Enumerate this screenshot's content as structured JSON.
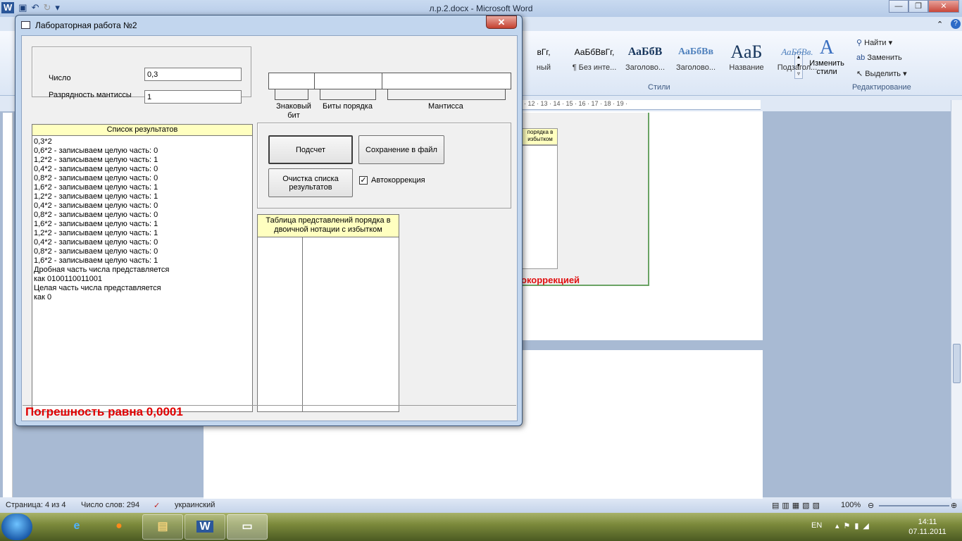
{
  "word": {
    "window_title": "л.р.2.docx - Microsoft Word",
    "styles": [
      {
        "preview": "вГг,",
        "label": "ный"
      },
      {
        "preview": "АаБбВвГг,",
        "label": "¶ Без инте..."
      },
      {
        "preview": "АаБбВ",
        "label": "Заголово..."
      },
      {
        "preview": "АаБбВв",
        "label": "Заголово..."
      },
      {
        "preview": "АаБ",
        "label": "Название"
      },
      {
        "preview": "АаБбВв.",
        "label": "Подзагол..."
      }
    ],
    "change_styles": "Изменить стили",
    "group_styles": "Стили",
    "find": "Найти",
    "replace": "Заменить",
    "select": "Выделить",
    "group_editing": "Редактирование",
    "ruler_text": "· 12 · 13 · 14 · 15 · 16 · 17 · 18 · 19 ·",
    "snapshot_header": "порядка в избытком",
    "snapshot_red": "окоррекцией",
    "status": {
      "page": "Страница: 4 из 4",
      "words": "Число слов: 294",
      "language": "украинский",
      "zoom": "100%"
    }
  },
  "taskbar": {
    "lang": "EN",
    "time": "14:11",
    "date": "07.11.2011"
  },
  "dialog": {
    "title": "Лабораторная работа №2",
    "number_label": "Число",
    "number_value": "0,3",
    "mantissa_label": "Разрядность мантиссы",
    "mantissa_value": "1",
    "sign_label": "Знаковый бит",
    "exponent_label": "Биты порядка",
    "mantissa_bits_label": "Мантисса",
    "results_header": "Список результатов",
    "results": [
      "0,3*2",
      "0,6*2 - записываем целую часть: 0",
      "1,2*2 - записываем целую часть: 1",
      "0,4*2 - записываем целую часть: 0",
      "0,8*2 - записываем целую часть: 0",
      "1,6*2 - записываем целую часть: 1",
      "1,2*2 - записываем целую часть: 1",
      "0,4*2 - записываем целую часть: 0",
      "0,8*2 - записываем целую часть: 0",
      "1,6*2 - записываем целую часть: 1",
      "1,2*2 - записываем целую часть: 1",
      "0,4*2 - записываем целую часть: 0",
      "0,8*2 - записываем целую часть: 0",
      "1,6*2 - записываем целую часть: 1",
      "Дробная часть числа представляется",
      "как 0100110011001",
      "Целая часть числа представляется",
      "как 0"
    ],
    "calc_button": "Подсчет",
    "save_button": "Сохранение в файл",
    "clear_button": "Очистка списка результатов",
    "autocorrect_label": "Автокоррекция",
    "autocorrect_checked": true,
    "table_header": "Таблица представлений порядка в двоичной нотации с избытком",
    "error_text": "Погрешность равна 0,0001"
  }
}
